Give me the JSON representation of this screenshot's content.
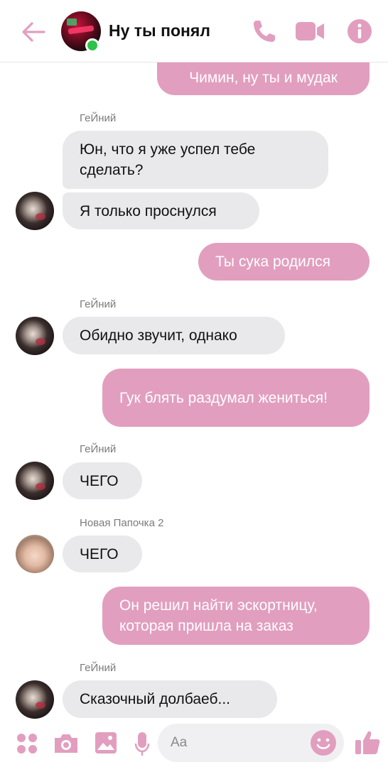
{
  "header": {
    "title": "Ну ты понял",
    "back_icon": "back-arrow-icon",
    "call_icon": "phone-icon",
    "video_icon": "video-camera-icon",
    "info_icon": "info-icon",
    "accent_color": "#e29ebf"
  },
  "messages": [
    {
      "side": "out",
      "text": "Чимин, ну ты и мудак"
    },
    {
      "side": "in",
      "sender": "ГеЙний",
      "text": "Юн, что я уже успел тебе сделать?"
    },
    {
      "side": "in",
      "text": "Я только проснулся"
    },
    {
      "side": "out",
      "text": "Ты сука родился"
    },
    {
      "side": "in",
      "sender": "ГеЙний",
      "text": "Обидно звучит, однако"
    },
    {
      "side": "out",
      "text": "Гук блять раздумал жениться!"
    },
    {
      "side": "in",
      "sender": "ГеЙний",
      "text": "ЧЕГО"
    },
    {
      "side": "in",
      "sender": "Новая Папочка 2",
      "text": "ЧЕГО"
    },
    {
      "side": "out",
      "text": "Он решил найти эскортницу, которая пришла на заказ"
    },
    {
      "side": "in",
      "sender": "ГеЙний",
      "text": "Сказочный долбаеб..."
    }
  ],
  "composer": {
    "placeholder": "Aa",
    "apps_icon": "four-dots-icon",
    "camera_icon": "camera-icon",
    "gallery_icon": "image-icon",
    "mic_icon": "microphone-icon",
    "emoji_icon": "smiley-icon",
    "like_icon": "thumbs-up-icon"
  },
  "colors": {
    "incoming_bubble": "#e9e9ec",
    "outgoing_bubble": "#e29ebf",
    "online": "#2dc24a"
  }
}
